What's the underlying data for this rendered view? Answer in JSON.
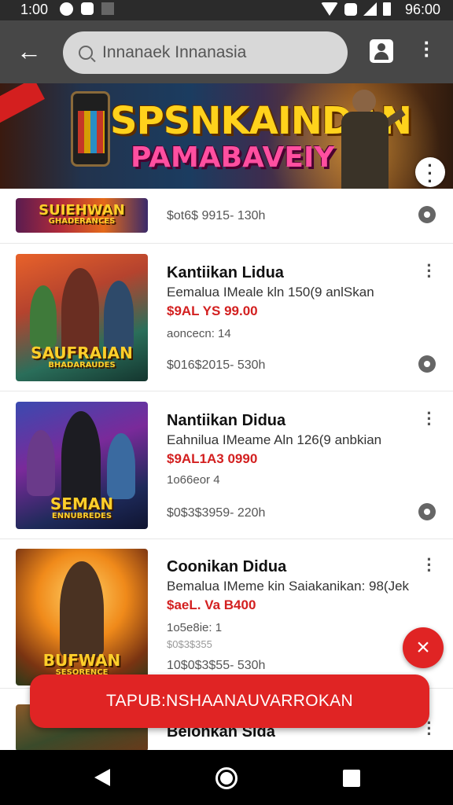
{
  "status_bar": {
    "time": "1:00",
    "clock_right": "96:00",
    "icons": [
      "app-notification-icon",
      "app-notification-icon",
      "image-icon",
      "wifi-icon",
      "data-icon",
      "signal-icon",
      "battery-icon"
    ]
  },
  "app_bar": {
    "back_icon": "arrow-left-icon",
    "search_value": "Innanaek Innanasia",
    "account_icon": "account-icon",
    "overflow_icon": "more-vertical-icon"
  },
  "banner": {
    "title_line1": "SPSNKAINDAN",
    "title_line2": "PAMABAVEIY",
    "more_icon": "more-vertical-icon"
  },
  "list": {
    "items": [
      {
        "thumb_label": "SUIEHWAN",
        "thumb_sublabel": "GHADERANCES",
        "meta": "$ot6$ 9915- 130h",
        "action_icon": "gear-icon"
      },
      {
        "thumb_label": "SAUFRAIAN",
        "thumb_sublabel": "BHADARAUDES",
        "title": "Kantiikan Lidua",
        "subtitle": "Eemalua IMeale kln 150(9 anlSkan",
        "price": "$9AL YS 99.00",
        "count": "aoncecn: 14",
        "meta": "$016$2015- 530h",
        "action_icon": "gear-icon"
      },
      {
        "thumb_label": "SEMAN",
        "thumb_sublabel": "ENNUBREDES",
        "title": "Nantiikan Didua",
        "subtitle": "Eahnilua IMeame Aln 126(9 anbkian",
        "price": "$9AL1A3 0990",
        "count": "1o66eor 4",
        "meta": "$0$3$3959- 220h",
        "action_icon": "gear-icon"
      },
      {
        "thumb_label": "BUFWAN",
        "thumb_sublabel": "SESORENCE",
        "title": "Coonikan Didua",
        "subtitle": "Bemalua IMeme kin Saiakanikan: 98(Jek",
        "price": "$aeL. Va B400",
        "count": "1o5e8ie: 1",
        "meta": "10$0$3$55- 530h",
        "meta_faint": "$0$3$355",
        "action_icon": "close-icon"
      },
      {
        "title": "Belonkan Sida"
      }
    ]
  },
  "cta": {
    "label": "TAPUB:NSHAANAUVARROKAN"
  },
  "fab": {
    "icon": "close-icon",
    "glyph": "×"
  },
  "nav_bar": {
    "icons": [
      "nav-back-icon",
      "nav-home-icon",
      "nav-recents-icon"
    ]
  },
  "colors": {
    "accent_red": "#e02424",
    "app_bar_bg": "#474747",
    "status_bar_bg": "#2b2b2b",
    "price_red": "#d32020"
  }
}
